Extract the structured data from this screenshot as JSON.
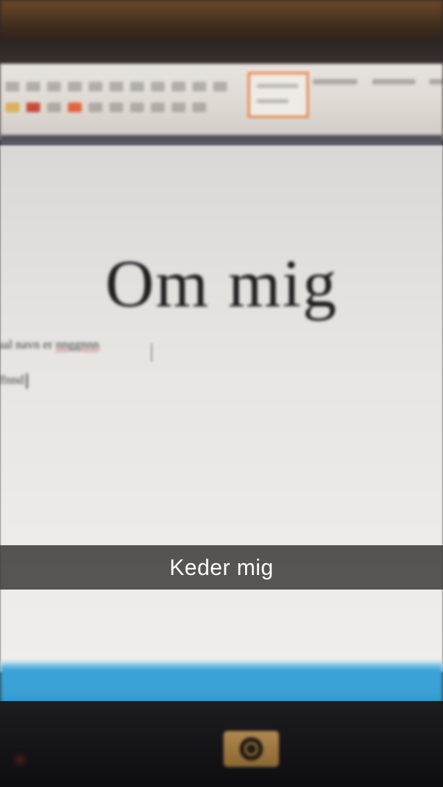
{
  "photo": {
    "subject": "blurry-photo-of-laptop-screen",
    "document": {
      "heading": "Om mig",
      "body_line_1_prefix": "ual navn er ",
      "body_line_1_misspelled": "nnggnnn",
      "body_line_2": "ffnnd"
    },
    "caption": "Keder mig"
  },
  "colors": {
    "ribbon_highlight": "#e77a3a",
    "status_bar": "#3aa1d4",
    "caption_bg": "#3c3a37",
    "hp_logo": "#b0894f"
  }
}
